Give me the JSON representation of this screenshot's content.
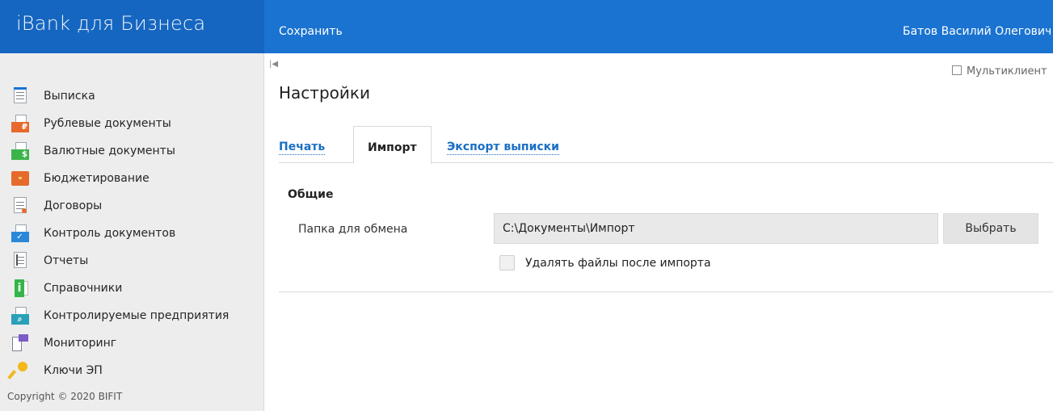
{
  "header": {
    "logo": "iBank для Бизнеса",
    "save_label": "Сохранить",
    "user_name": "Батов Василий Олегович"
  },
  "sidebar": {
    "items": [
      {
        "label": "Выписка",
        "icon": "statement-icon"
      },
      {
        "label": "Рублевые документы",
        "icon": "ruble-documents-icon"
      },
      {
        "label": "Валютные документы",
        "icon": "currency-documents-icon"
      },
      {
        "label": "Бюджетирование",
        "icon": "budgeting-icon"
      },
      {
        "label": "Договоры",
        "icon": "contracts-icon"
      },
      {
        "label": "Контроль документов",
        "icon": "document-control-icon"
      },
      {
        "label": "Отчеты",
        "icon": "reports-icon"
      },
      {
        "label": "Справочники",
        "icon": "directories-icon"
      },
      {
        "label": "Контролируемые предприятия",
        "icon": "controlled-enterprises-icon"
      },
      {
        "label": "Мониторинг",
        "icon": "monitoring-icon"
      },
      {
        "label": "Ключи ЭП",
        "icon": "key-icon"
      }
    ],
    "copyright": "Copyright © 2020 BIFIT"
  },
  "main": {
    "multiclient_label": "Мультиклиент",
    "title": "Настройки",
    "tabs": [
      {
        "label": "Печать",
        "active": false
      },
      {
        "label": "Импорт",
        "active": true
      },
      {
        "label": "Экспорт выписки",
        "active": false
      }
    ],
    "section_title": "Общие",
    "exchange_folder_label": "Папка для обмена",
    "exchange_folder_value": "C:\\Документы\\Импорт",
    "choose_label": "Выбрать",
    "delete_files_label": "Удалять файлы после импорта",
    "delete_files_checked": false
  },
  "colors": {
    "header_bg": "#1a73d0",
    "logo_bg": "#1566c0",
    "sidebar_bg": "#ededed",
    "link": "#1a6fc4"
  }
}
